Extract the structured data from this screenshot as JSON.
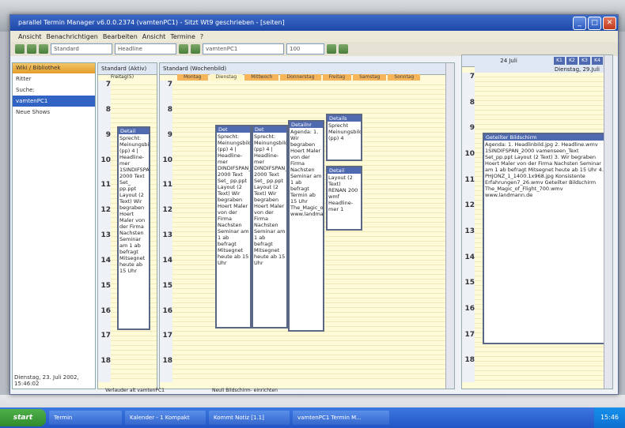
{
  "window": {
    "title": "parallel Termin Manager v6.0.0.2374 (vamtenPC1) - Sitzt Wt9 geschrieben - [seiten]"
  },
  "menu": [
    "Ansicht",
    "Benachrichtigen",
    "Bearbeiten",
    "Ansicht",
    "Termine",
    "?"
  ],
  "toolbar": {
    "combo1": "Standard",
    "combo2": "Headline",
    "combo3": "vamtenPC1",
    "zoom": "100"
  },
  "left_panel": {
    "header": "Wiki / Bibliothek",
    "label1": "Ritter",
    "label2": "Suche:",
    "items": [
      "vamtenPC1",
      "Neue Shows"
    ],
    "status": "Dienstag, 23. Juli 2002, 15:46:02"
  },
  "day1": {
    "header": "Standard (Aktiv)",
    "date": "Freitag(5)"
  },
  "week": {
    "header": "Standard (Wochenbild)",
    "tabs": [
      "Montag",
      "Dienstag",
      "Mittwoch",
      "Donnerstag",
      "Freitag",
      "Samstag",
      "Sonntag"
    ]
  },
  "hours": [
    "7",
    "8",
    "9",
    "10",
    "11",
    "12",
    "13",
    "14",
    "15",
    "16",
    "17",
    "18"
  ],
  "events": [
    {
      "title": "Detail",
      "body": "Sprecht: Meinungsbild (pp) 4 | Headline-mer 1SINDIFSPAN_ 2000 Text Set_ pp.ppt Layout (2 Text) Wir begraben Hoert Maler von der Firma Nachsten Seminar am 1 ab befragt Mitsegnet heute ab 15 Uhr"
    },
    {
      "title": "Det",
      "body": "Sprecht: Meinungsbild (pp) 4 | Headline-mer DINDIFSPAN_ 2000 Text Set_ pp.ppt Layout (2 Text) Wir begraben Hoert Maler von der Firma Nachsten Seminar am 1 ab befragt Mitsegnet heute ab 15 Uhr"
    },
    {
      "title": "Det",
      "body": "Sprecht: Meinungsbild (pp) 4 | Headline-mer DINDIFSPAN_ 2000 Text Set_ pp.ppt Layout (2 Text) Wir begraben Hoert Maler von der Firma Nachsten Seminar am 1 ab befragt Mitsegnet heute ab 15 Uhr"
    },
    {
      "title": "Detailnr",
      "body": "Agenda: 1. Wir begraben Hoert Maler von der Firma Nachsten Seminar am 1 ab befragt Termin ab 15 Uhr The_Magic_of_Flight_700.wmv www.landmann.de"
    },
    {
      "title": "Details",
      "body": "Sprecht Meinungsbild (pp) 4"
    },
    {
      "title": "Detail",
      "body": "Layout (2 Text) RENAN 200 wmf Headline-mer 1"
    }
  ],
  "right_panel": {
    "header": "24 Juli",
    "date": "Dienstag, 29.Juli",
    "kw": [
      "K1",
      "K2",
      "K3",
      "K4"
    ],
    "event_title": "Geteilter Bildschirm",
    "event_body": "Agenda: 1. Headlinbild.jpg 2. Headline.wmv 1SINDIFSPAN_2000 vamenseen_Text Set_pp.ppt Layout (2 Text) 3. Wir begraben Hoert Maler von der Firma Nachsten Seminar am 1 ab befragt Mitsegnet heute ab 15 Uhr 4. PHJONZ_1_1400.1x968.jpg Konsistente Erfahrungen7_26.wmv Geteilter Bildschirm The_Magic_of_Flight_700.wmv www.landmann.de"
  },
  "status": {
    "left": "Verlauder alt vamtenPC1",
    "mid": "Neuli Bildschirm- einrichten"
  },
  "taskbar": {
    "start": "start",
    "items": [
      "Termin",
      "Kalender - 1 Kompakt",
      "Kommt Notiz [1.1]",
      "vamtenPC1 Termin M..."
    ],
    "clock": "15:46"
  }
}
